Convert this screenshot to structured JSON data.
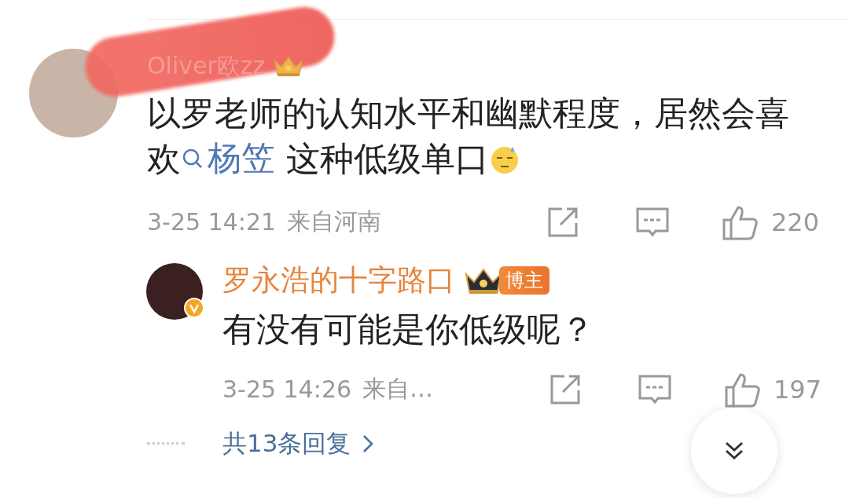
{
  "comments": [
    {
      "user": {
        "name": "Oliver欧zz",
        "redacted": true
      },
      "text_before": "以罗老师的认知水平和幽默程度，居然会喜欢",
      "topic": "杨笠",
      "text_after": " 这种低级单口",
      "time": "3-25 14:21",
      "location": "来自河南",
      "likes": "220",
      "replies": [
        {
          "name": "罗永浩的十字路口",
          "badge": "博主",
          "verified": true,
          "text": "有没有可能是你低级呢？",
          "time": "3-25 14:26",
          "location": "来自…",
          "likes": "197"
        }
      ],
      "reply_count_link": "共13条回复"
    }
  ]
}
